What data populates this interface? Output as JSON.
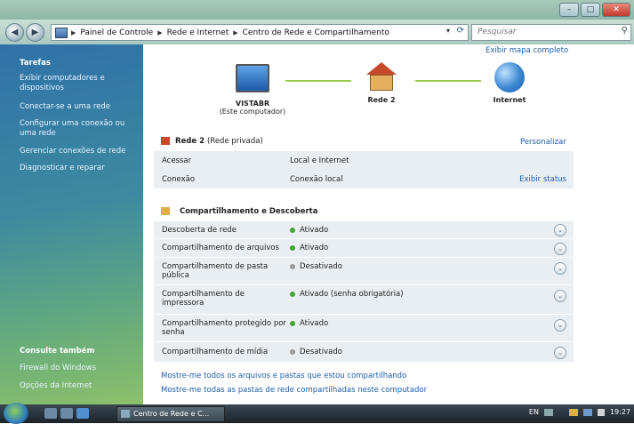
{
  "window": {
    "buttons": {
      "minimize": "–",
      "maximize": "□",
      "close": "✕"
    }
  },
  "navbar": {
    "back": "◀",
    "forward": "▶",
    "breadcrumbs": [
      "Painel de Controle",
      "Rede e Internet",
      "Centro de Rede e Compartilhamento"
    ],
    "separator": "▶",
    "search_placeholder": "Pesquisar",
    "icons": {
      "dropdown": "▾",
      "refresh": "⟳",
      "search": "⚲"
    }
  },
  "sidebar": {
    "heading": "Tarefas",
    "tasks": [
      "Exibir computadores e dispositivos",
      "Conectar-se a uma rede",
      "Configurar uma conexão ou uma rede",
      "Gerenciar conexões de rede",
      "Diagnosticar e reparar"
    ],
    "see_also_heading": "Consulte também",
    "see_also": [
      "Firewall do Windows",
      "Opções da Internet"
    ]
  },
  "network_map": {
    "link": "Exibir mapa completo",
    "nodes": [
      {
        "name": "VISTABR",
        "sub": "(Este computador)",
        "icon": "computer-icon"
      },
      {
        "name": "Rede 2",
        "sub": "",
        "icon": "house-icon"
      },
      {
        "name": "Internet",
        "sub": "",
        "icon": "globe-icon"
      }
    ]
  },
  "network": {
    "title": "Rede 2",
    "type": "(Rede privada)",
    "customize_link": "Personalizar",
    "rows": [
      {
        "label": "Acessar",
        "value": "Local e Internet",
        "action": ""
      },
      {
        "label": "Conexão",
        "value": "Conexão local",
        "action": "Exibir status"
      }
    ]
  },
  "sharing": {
    "title": "Compartilhamento e Descoberta",
    "rows": [
      {
        "label": "Descoberta de rede",
        "status": "Ativado",
        "state": "on"
      },
      {
        "label": "Compartilhamento de arquivos",
        "status": "Ativado",
        "state": "on"
      },
      {
        "label": "Compartilhamento de pasta pública",
        "status": "Desativado",
        "state": "off"
      },
      {
        "label": "Compartilhamento de impressora",
        "status": "Ativado (senha obrigatória)",
        "state": "on"
      },
      {
        "label": "Compartilhamento protegido por senha",
        "status": "Ativado",
        "state": "on"
      },
      {
        "label": "Compartilhamento de mídia",
        "status": "Desativado",
        "state": "off"
      }
    ],
    "expand_icon": "⌄"
  },
  "bottom_links": [
    "Mostre-me todos os arquivos e pastas que estou compartilhando",
    "Mostre-me todas as pastas de rede compartilhadas neste computador"
  ],
  "taskbar": {
    "task": "Centro de Rede e C...",
    "lang": "EN",
    "clock": "19:27"
  },
  "colors": {
    "sidebar_top": "#2f72a8",
    "sidebar_bottom": "#8dc06a",
    "link": "#1c5cab",
    "status_on": "#43a433",
    "status_off": "#9a9a9a",
    "connector": "#9acd4a"
  }
}
